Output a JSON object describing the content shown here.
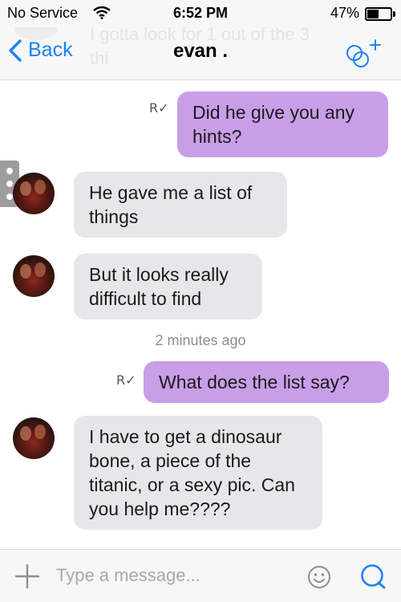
{
  "status_bar": {
    "carrier": "No Service",
    "time": "6:52 PM",
    "battery_percent": "47%",
    "battery_level": 0.47,
    "wifi_icon": "wifi-icon"
  },
  "nav": {
    "back_label": "Back",
    "title": "evan .",
    "background_text": "I gotta look for 1 out of the 3 thi",
    "action_icon": "group-add-icon"
  },
  "messages": [
    {
      "direction": "out",
      "text": "Did he give you any hints?",
      "read_mark": "R✓"
    },
    {
      "direction": "in",
      "text": "He gave me a list of things"
    },
    {
      "direction": "in",
      "text": "But it looks really difficult to find"
    },
    {
      "direction": "out",
      "text": "What does the list say?",
      "read_mark": "R✓"
    },
    {
      "direction": "in",
      "text": "I have to get a dinosaur bone, a piece of the titanic, or a sexy pic. Can you help me????"
    }
  ],
  "timestamp": "2 minutes ago",
  "composer": {
    "placeholder": "Type a message...",
    "plus_icon": "plus-icon",
    "emoji_icon": "smiley-icon",
    "send_icon": "send-icon"
  },
  "colors": {
    "accent": "#1d82f5",
    "outgoing_bubble": "#c99ee8",
    "incoming_bubble": "#e7e7ea"
  }
}
